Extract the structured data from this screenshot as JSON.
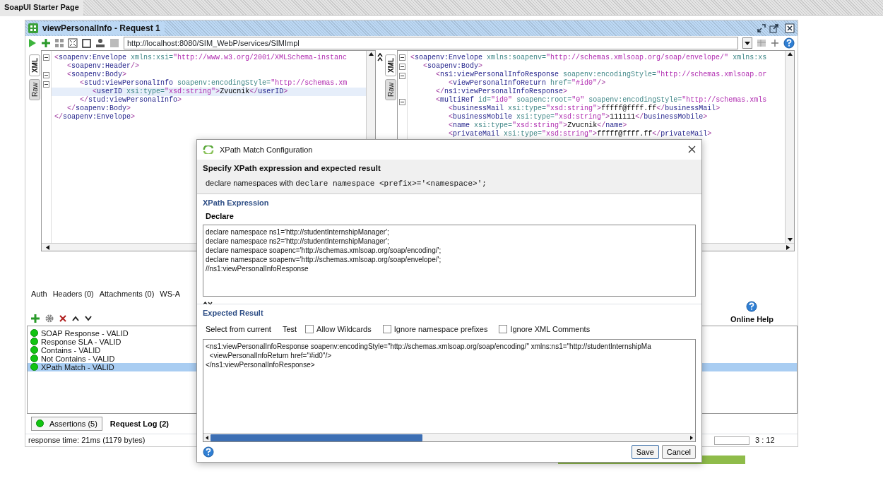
{
  "page_tab": {
    "title": "SoapUI Starter Page"
  },
  "request_window": {
    "title": "viewPersonalInfo - Request 1",
    "endpoint": "http://localhost:8080/SIM_WebP/services/SIMImpl",
    "request_editor": {
      "tabs": [
        {
          "label": "XML",
          "selected": true
        },
        {
          "label": "Raw",
          "selected": false
        }
      ],
      "lines": [
        {
          "text": "<soapenv:Envelope xmlns:xsi=\"http://www.w3.org/2001/XMLSchema-instanc",
          "foldable": true,
          "current": false
        },
        {
          "text": "   <soapenv:Header/>",
          "foldable": false,
          "current": false
        },
        {
          "text": "   <soapenv:Body>",
          "foldable": true,
          "current": false
        },
        {
          "text": "      <stud:viewPersonalInfo soapenv:encodingStyle=\"http://schemas.xm",
          "foldable": true,
          "current": false
        },
        {
          "text": "         <userID xsi:type=\"xsd:string\">Zvucnik</userID>",
          "foldable": false,
          "current": true
        },
        {
          "text": "      </stud:viewPersonalInfo>",
          "foldable": false,
          "current": false
        },
        {
          "text": "   </soapenv:Body>",
          "foldable": false,
          "current": false
        },
        {
          "text": "</soapenv:Envelope>",
          "foldable": false,
          "current": false
        }
      ]
    },
    "response_editor": {
      "tabs": [
        {
          "label": "XML",
          "selected": true
        },
        {
          "label": "Raw",
          "selected": false
        }
      ],
      "lines": [
        {
          "text": "<soapenv:Envelope xmlns:soapenv=\"http://schemas.xmlsoap.org/soap/envelope/\" xmlns:xs",
          "foldable": true,
          "current": false
        },
        {
          "text": "   <soapenv:Body>",
          "foldable": true,
          "current": false
        },
        {
          "text": "      <ns1:viewPersonalInfoResponse soapenv:encodingStyle=\"http://schemas.xmlsoap.or",
          "foldable": true,
          "current": false
        },
        {
          "text": "         <viewPersonalInfoReturn href=\"#id0\"/>",
          "foldable": false,
          "current": false
        },
        {
          "text": "      </ns1:viewPersonalInfoResponse>",
          "foldable": false,
          "current": false
        },
        {
          "text": "      <multiRef id=\"id0\" soapenc:root=\"0\" soapenv:encodingStyle=\"http://schemas.xmls",
          "foldable": true,
          "current": false
        },
        {
          "text": "         <businessMail xsi:type=\"xsd:string\">fffff@ffff.ff</businessMail>",
          "foldable": false,
          "current": false
        },
        {
          "text": "         <businessMobile xsi:type=\"xsd:string\">111111</businessMobile>",
          "foldable": false,
          "current": false
        },
        {
          "text": "         <name xsi:type=\"xsd:string\">Zvucnik</name>",
          "foldable": false,
          "current": false
        },
        {
          "text": "         <privateMail xsi:type=\"xsd:string\">fffff@ffff.ff</privateMail>",
          "foldable": false,
          "current": false
        }
      ]
    },
    "request_tabs": [
      "Auth",
      "Headers (0)",
      "Attachments (0)",
      "WS-A"
    ],
    "online_help": "Online Help",
    "assertions": [
      {
        "label": "SOAP Response - VALID",
        "selected": false
      },
      {
        "label": "Response SLA - VALID",
        "selected": false
      },
      {
        "label": "Contains - VALID",
        "selected": false
      },
      {
        "label": "Not Contains - VALID",
        "selected": false
      },
      {
        "label": "XPath Match - VALID",
        "selected": true
      }
    ],
    "bottom_tabs": [
      {
        "label": "Assertions (5)",
        "selected": true
      },
      {
        "label": "Request Log (2)",
        "selected": false
      }
    ],
    "status_bar": {
      "response_time": "response time: 21ms (1179 bytes)",
      "position": "3 : 12"
    }
  },
  "dialog": {
    "title": "XPath Match Configuration",
    "heading": "Specify XPath expression and expected result",
    "description": "declare namespaces with ",
    "description_code": "declare namespace <prefix>='<namespace>';",
    "xpath_section": "XPath Expression",
    "declare_button": "Declare",
    "xpath_lines": [
      "declare namespace ns1='http://studentInternshipManager';",
      "declare namespace ns2='http://studentInternshipManager';",
      "declare namespace soapenc='http://schemas.xmlsoap.org/soap/encoding/';",
      "declare namespace soapenv='http://schemas.xmlsoap.org/soap/envelope/';",
      "//ns1:viewPersonalInfoResponse"
    ],
    "expected_section": "Expected Result",
    "tool_buttons": [
      "Select from current",
      "Test"
    ],
    "options": [
      {
        "label": "Allow Wildcards",
        "checked": false
      },
      {
        "label": "Ignore namespace prefixes",
        "checked": false
      },
      {
        "label": "Ignore XML Comments",
        "checked": false
      }
    ],
    "expected_lines": [
      "<ns1:viewPersonalInfoResponse soapenv:encodingStyle=\"http://schemas.xmlsoap.org/soap/encoding/\" xmlns:ns1=\"http://studentInternshipMa",
      "  <viewPersonalInfoReturn href=\"#id0\"/>",
      "</ns1:viewPersonalInfoResponse>"
    ],
    "buttons": [
      "Save",
      "Cancel"
    ]
  }
}
